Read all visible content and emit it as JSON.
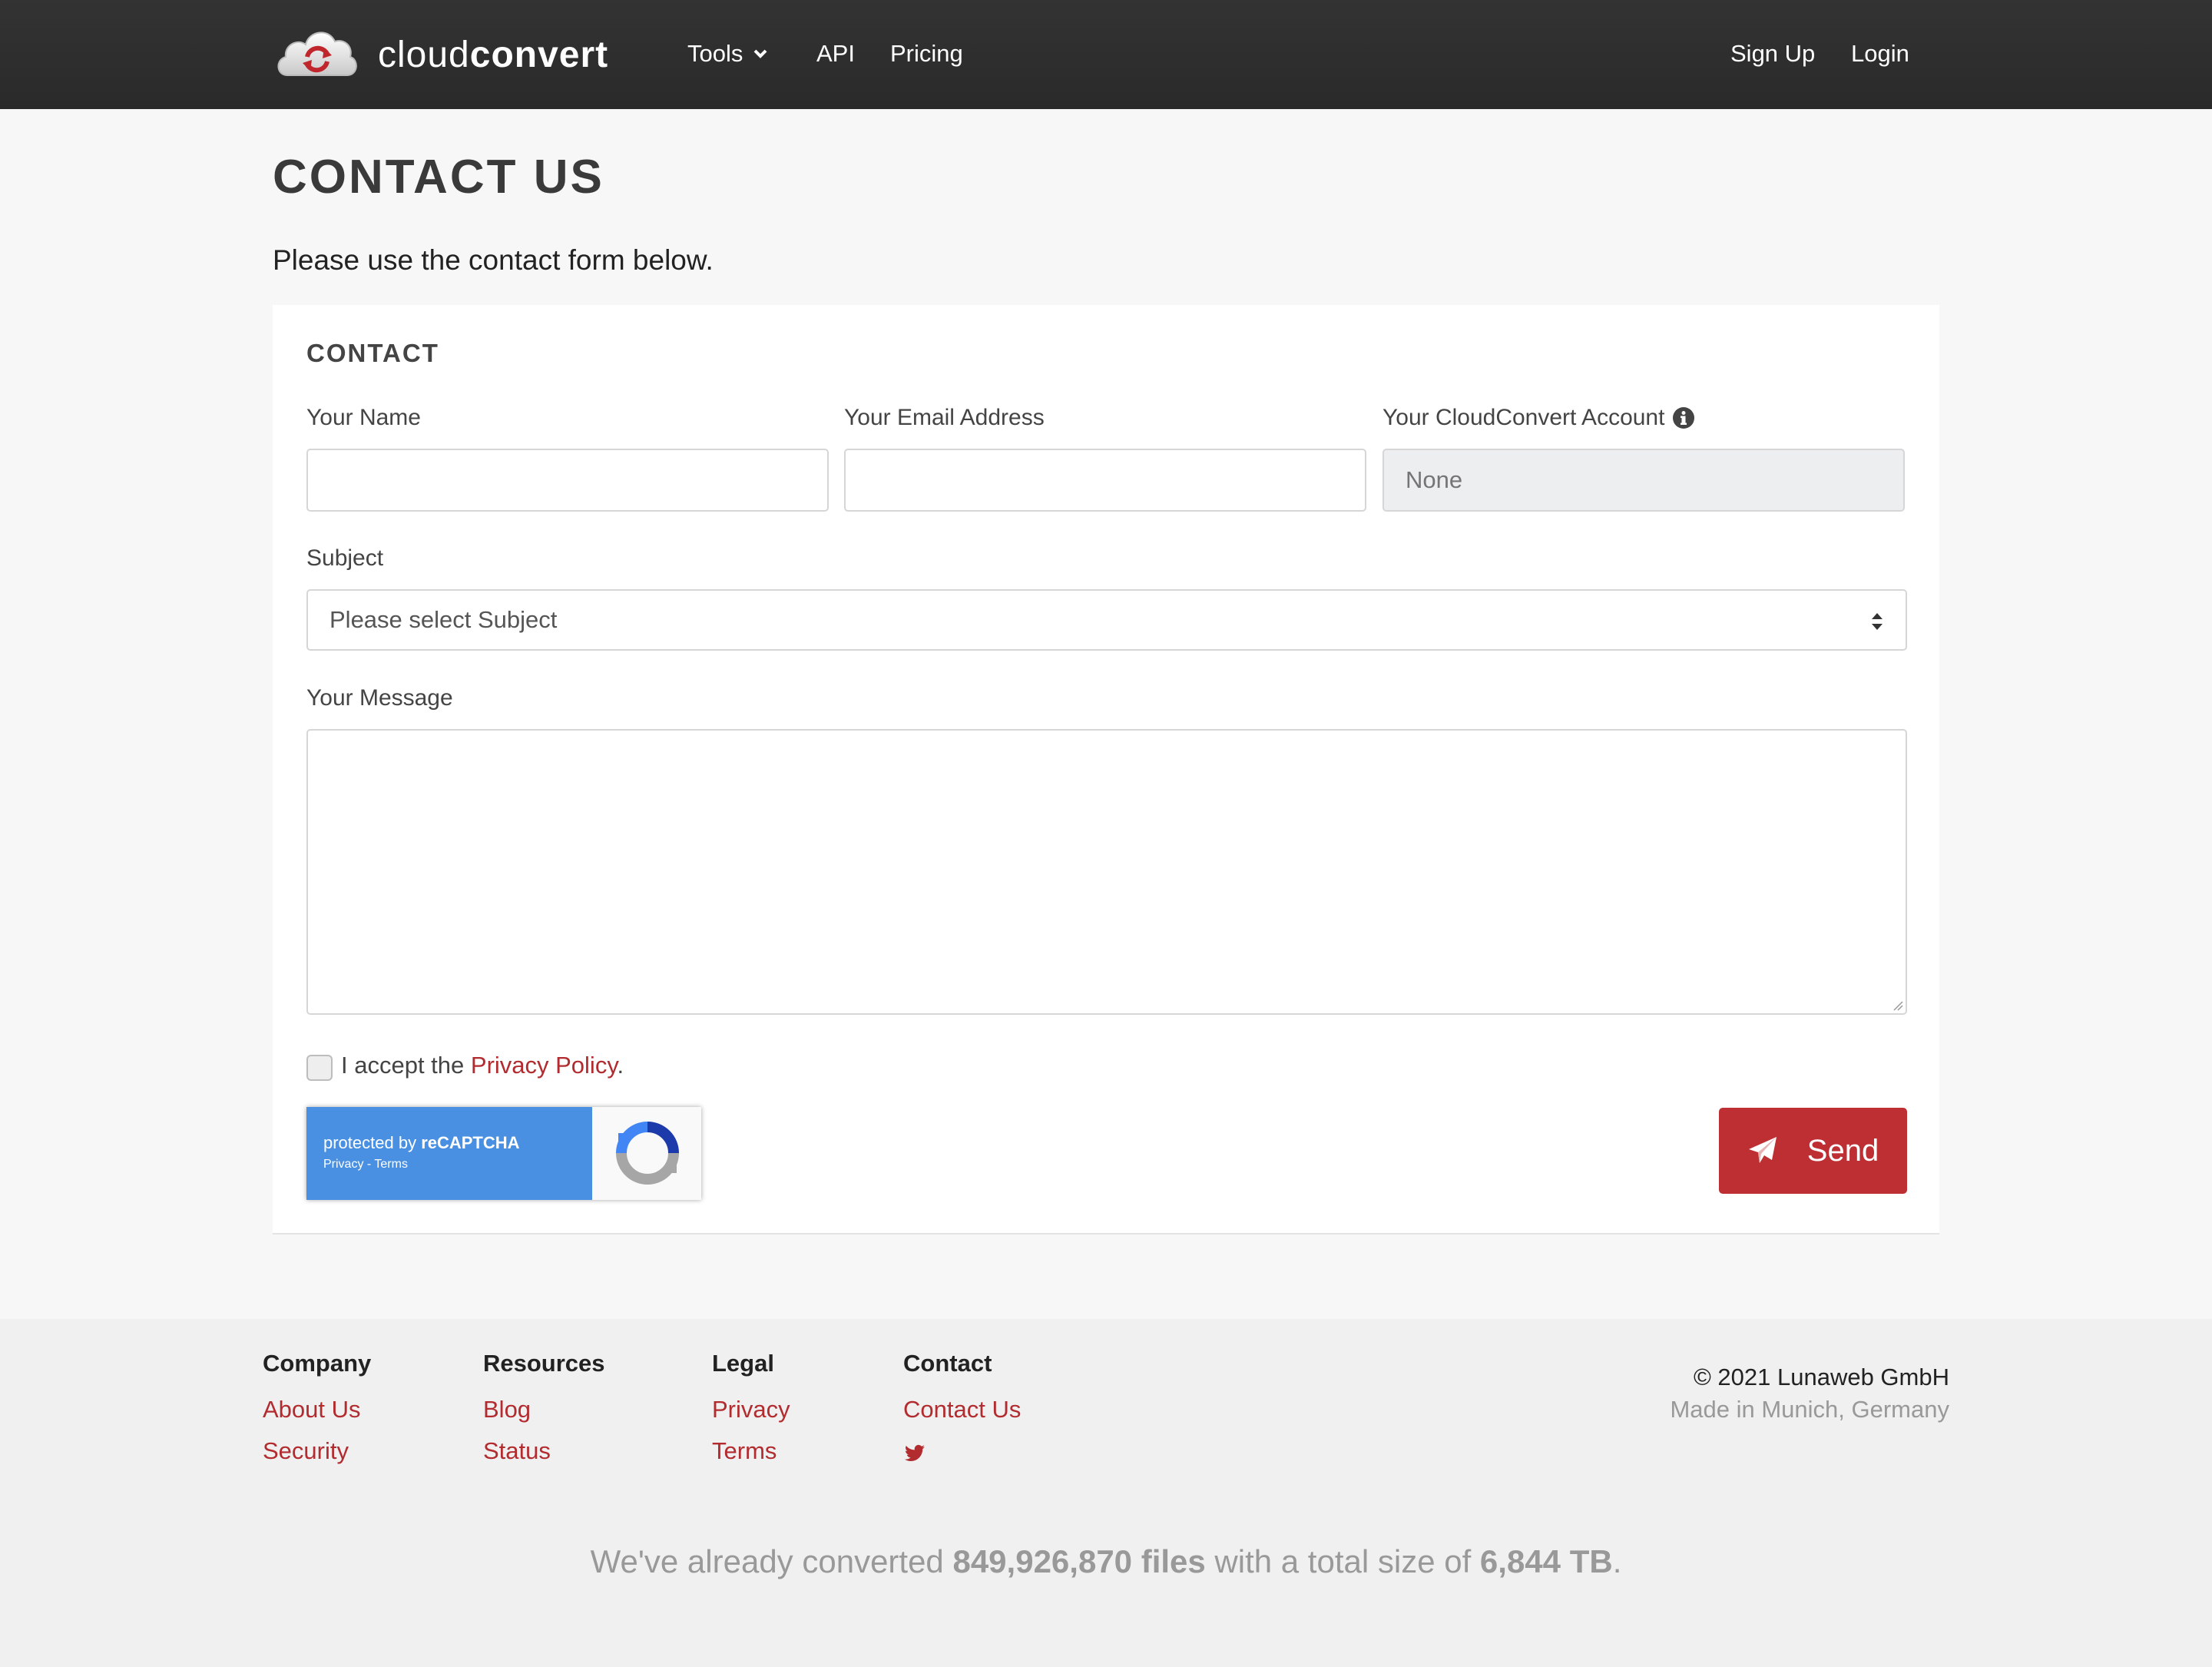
{
  "brand": {
    "name_light": "cloud",
    "name_bold": "convert",
    "logo_icon": "cloud-convert-logo-icon"
  },
  "nav": {
    "tools": "Tools",
    "api": "API",
    "pricing": "Pricing",
    "signup": "Sign Up",
    "login": "Login"
  },
  "page": {
    "title": "CONTACT US",
    "intro": "Please use the contact form below."
  },
  "form": {
    "card_title": "CONTACT",
    "name_label": "Your Name",
    "name_value": "",
    "email_label": "Your Email Address",
    "email_value": "",
    "account_label": "Your CloudConvert Account",
    "account_placeholder": "None",
    "subject_label": "Subject",
    "subject_selected": "Please select Subject",
    "message_label": "Your Message",
    "message_value": "",
    "accept_prefix": "I accept the ",
    "accept_link": "Privacy Policy",
    "accept_suffix": ".",
    "recaptcha_prefix": "protected by ",
    "recaptcha_brand": "reCAPTCHA",
    "recaptcha_links": "Privacy - Terms",
    "send_label": "Send"
  },
  "footer": {
    "company": {
      "heading": "Company",
      "links": [
        "About Us",
        "Security"
      ]
    },
    "resources": {
      "heading": "Resources",
      "links": [
        "Blog",
        "Status"
      ]
    },
    "legal": {
      "heading": "Legal",
      "links": [
        "Privacy",
        "Terms"
      ]
    },
    "contact": {
      "heading": "Contact",
      "links": [
        "Contact Us"
      ],
      "social_icon": "twitter-icon"
    },
    "copyright": "© 2021 Lunaweb GmbH",
    "made_in": "Made in Munich, Germany",
    "stats": {
      "prefix": "We've already converted ",
      "files": "849,926,870 files",
      "middle": " with a total size of ",
      "size": "6,844 TB",
      "suffix": "."
    }
  },
  "colors": {
    "navbar": "#2f2f2f",
    "accent": "#bd2f33",
    "link": "#b22b2f",
    "recaptcha_blue": "#4a90e2"
  }
}
